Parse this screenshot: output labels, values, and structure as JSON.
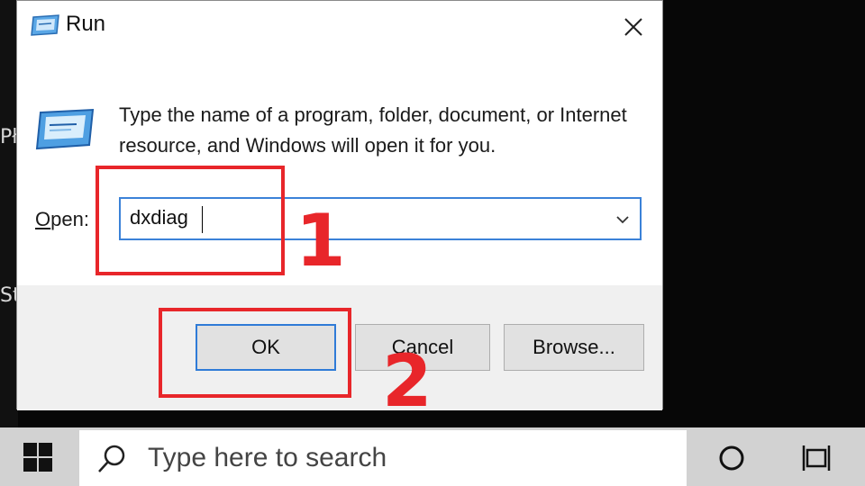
{
  "dialog": {
    "title": "Run",
    "description": "Type the name of a program, folder, document, or Internet resource, and Windows will open it for you.",
    "open_label_underlined": "O",
    "open_label_rest": "pen:",
    "open_value": "dxdiag",
    "buttons": {
      "ok": "OK",
      "cancel": "Cancel",
      "browse": "Browse..."
    }
  },
  "annotations": {
    "step1": "1",
    "step2": "2"
  },
  "desktop": {
    "partial_text_a": "Pł",
    "partial_text_b": "St"
  },
  "taskbar": {
    "search_placeholder": "Type here to search"
  },
  "colors": {
    "accent_blue": "#2f7bd7",
    "callout_red": "#e8262a",
    "taskbar_gray": "#d2d2d2"
  }
}
